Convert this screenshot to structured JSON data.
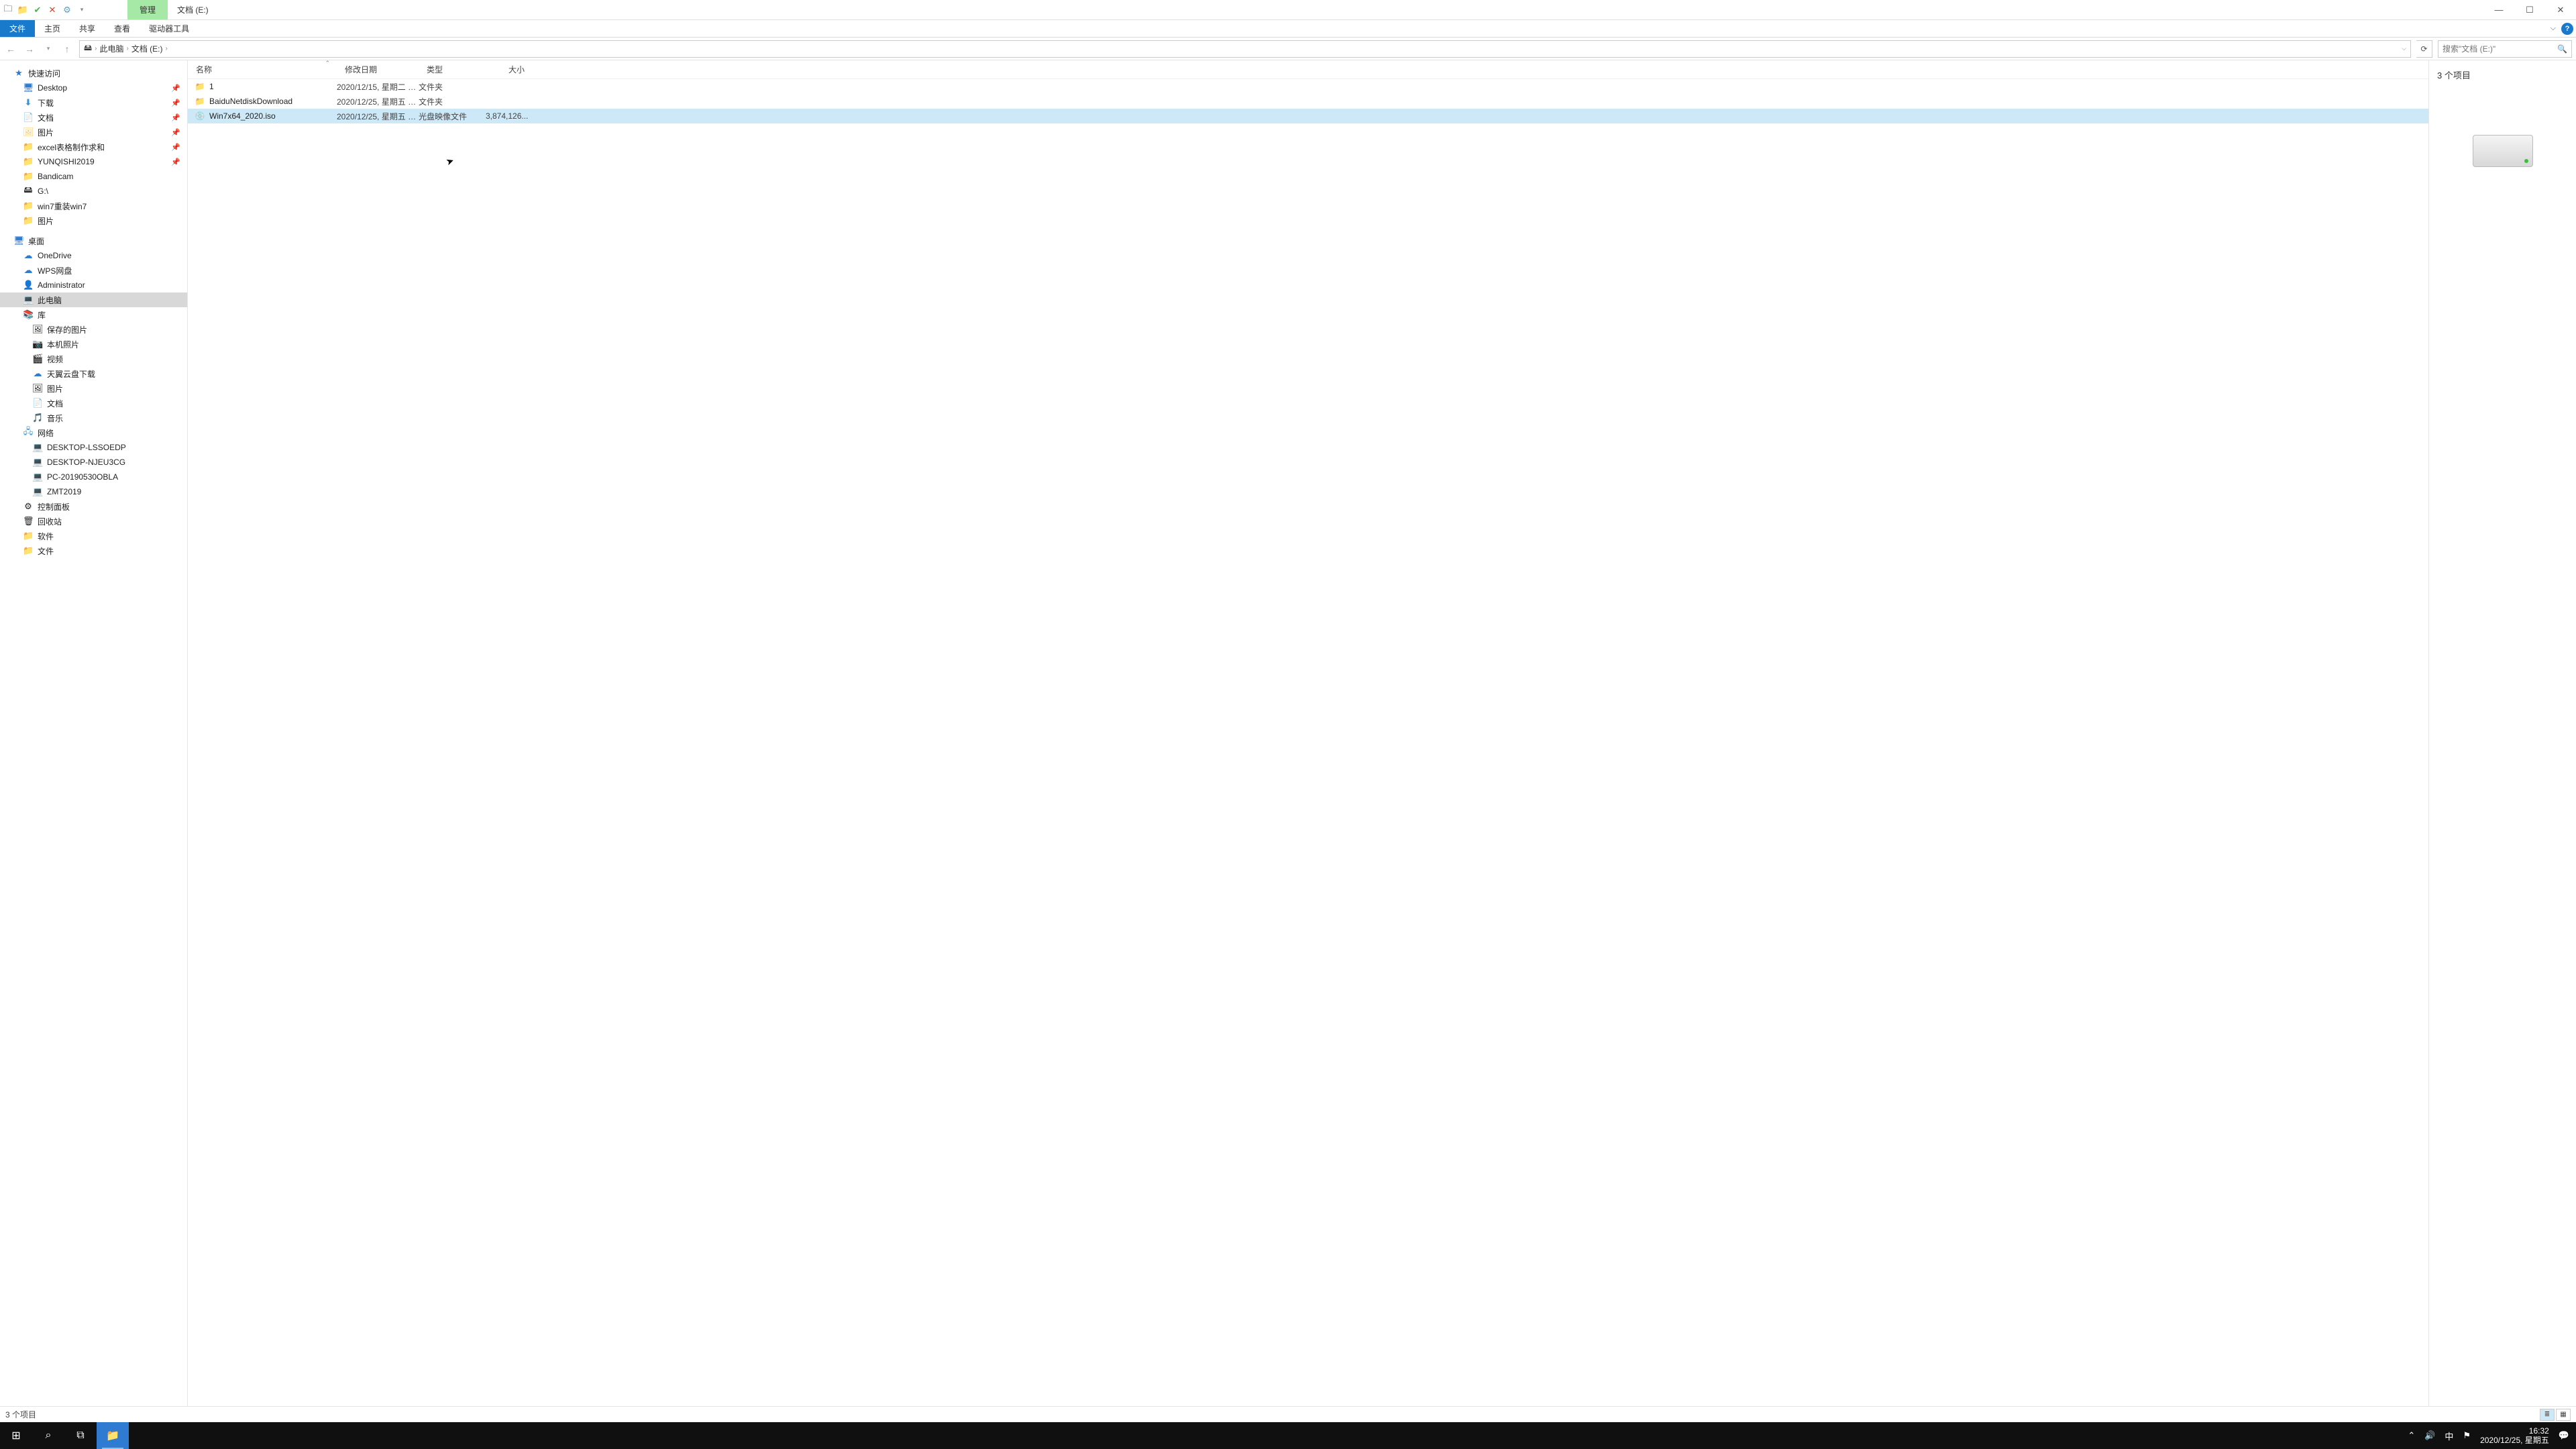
{
  "titlebar": {
    "manage": "管理",
    "title": "文档 (E:)"
  },
  "ribbon": {
    "file": "文件",
    "home": "主页",
    "share": "共享",
    "view": "查看",
    "drive_tools": "驱动器工具"
  },
  "breadcrumb": {
    "this_pc": "此电脑",
    "drive": "文档 (E:)"
  },
  "search": {
    "placeholder": "搜索\"文档 (E:)\""
  },
  "columns": {
    "name": "名称",
    "date": "修改日期",
    "type": "类型",
    "size": "大小"
  },
  "nav": {
    "quick_access": "快速访问",
    "desktop": "Desktop",
    "downloads": "下载",
    "documents": "文档",
    "pictures": "图片",
    "excel": "excel表格制作求和",
    "yunqishi": "YUNQISHI2019",
    "bandicam": "Bandicam",
    "g_drive": "G:\\",
    "win7": "win7重装win7",
    "pictures2": "图片",
    "desktop_cn": "桌面",
    "onedrive": "OneDrive",
    "wps": "WPS网盘",
    "admin": "Administrator",
    "this_pc": "此电脑",
    "libraries": "库",
    "saved_pics": "保存的图片",
    "camera": "本机照片",
    "videos": "视频",
    "tianyi": "天翼云盘下载",
    "pictures3": "图片",
    "docs3": "文档",
    "music": "音乐",
    "network": "网络",
    "d1": "DESKTOP-LSSOEDP",
    "d2": "DESKTOP-NJEU3CG",
    "d3": "PC-20190530OBLA",
    "d4": "ZMT2019",
    "control_panel": "控制面板",
    "recycle": "回收站",
    "software": "软件",
    "files": "文件"
  },
  "files": [
    {
      "name": "1",
      "date": "2020/12/15, 星期二 1...",
      "type": "文件夹",
      "size": "",
      "icon": "folder",
      "sel": false
    },
    {
      "name": "BaiduNetdiskDownload",
      "date": "2020/12/25, 星期五 1...",
      "type": "文件夹",
      "size": "",
      "icon": "folder",
      "sel": false
    },
    {
      "name": "Win7x64_2020.iso",
      "date": "2020/12/25, 星期五 1...",
      "type": "光盘映像文件",
      "size": "3,874,126...",
      "icon": "disc",
      "sel": true
    }
  ],
  "preview": {
    "count": "3 个项目"
  },
  "status": {
    "text": "3 个项目"
  },
  "clock": {
    "time": "16:32",
    "date": "2020/12/25, 星期五"
  },
  "tray": {
    "ime": "中"
  }
}
